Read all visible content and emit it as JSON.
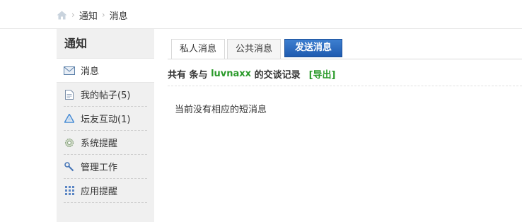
{
  "breadcrumb": {
    "items": [
      "通知",
      "消息"
    ],
    "separator": "›"
  },
  "sidebar": {
    "title": "通知",
    "items": [
      {
        "label": "消息",
        "icon": "envelope-icon",
        "active": true
      },
      {
        "label": "我的帖子(5)",
        "icon": "document-icon"
      },
      {
        "label": "坛友互动(1)",
        "icon": "recycle-icon"
      },
      {
        "label": "系统提醒",
        "icon": "gear-icon"
      },
      {
        "label": "管理工作",
        "icon": "tools-icon"
      },
      {
        "label": "应用提醒",
        "icon": "grid-icon"
      }
    ]
  },
  "tabs": [
    {
      "label": "私人消息",
      "active": true
    },
    {
      "label": "公共消息"
    }
  ],
  "send_button": "发送消息",
  "summary": {
    "prefix": "共有 条与 ",
    "username": "luvnaxx",
    "suffix": " 的交谈记录",
    "export": "[导出]"
  },
  "empty_message": "当前没有相应的短消息",
  "colors": {
    "accent_green": "#2a9a2a",
    "button_blue": "#2a6cc0"
  }
}
